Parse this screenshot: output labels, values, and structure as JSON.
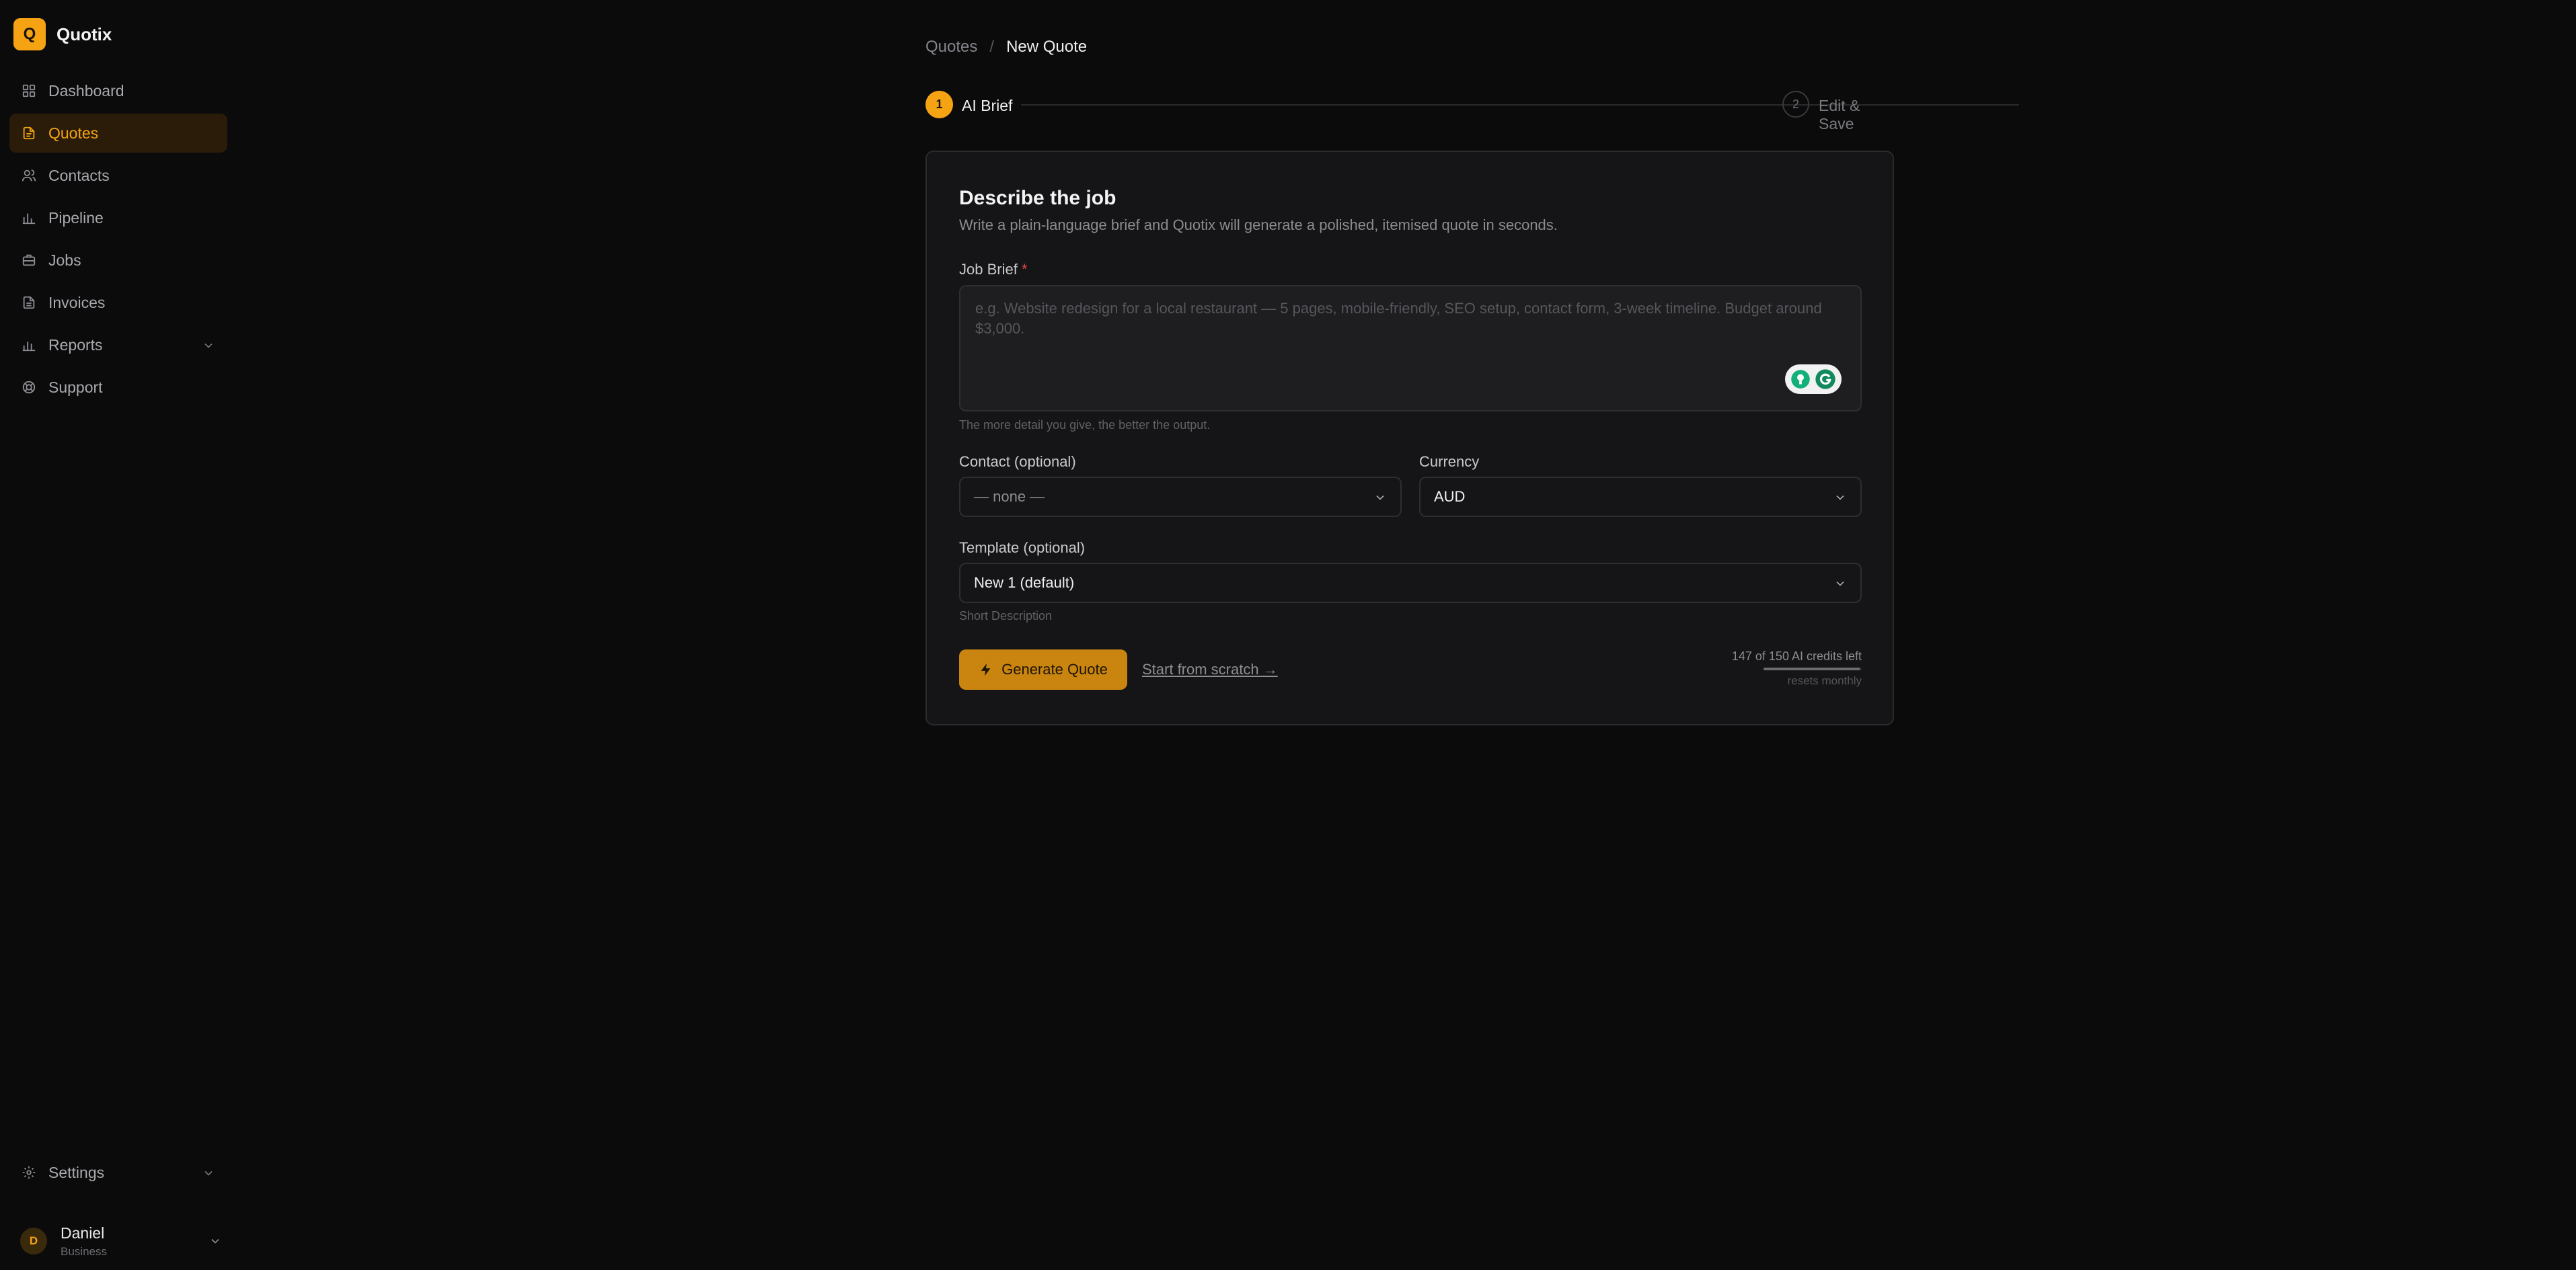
{
  "app": {
    "name": "Quotix",
    "logo_letter": "Q"
  },
  "sidebar": {
    "items": [
      {
        "label": "Dashboard",
        "icon": "grid-icon"
      },
      {
        "label": "Quotes",
        "icon": "document-icon",
        "active": true
      },
      {
        "label": "Contacts",
        "icon": "users-icon"
      },
      {
        "label": "Pipeline",
        "icon": "bar-chart-icon"
      },
      {
        "label": "Jobs",
        "icon": "briefcase-icon"
      },
      {
        "label": "Invoices",
        "icon": "invoice-icon"
      },
      {
        "label": "Reports",
        "icon": "bar-chart-icon",
        "has_chevron": true
      },
      {
        "label": "Support",
        "icon": "support-icon"
      }
    ],
    "settings_label": "Settings",
    "user": {
      "initial": "D",
      "name": "Daniel",
      "plan": "Business"
    }
  },
  "breadcrumb": {
    "parent": "Quotes",
    "separator": "/",
    "current": "New Quote"
  },
  "stepper": {
    "step1": {
      "number": "1",
      "label": "AI Brief"
    },
    "step2": {
      "number": "2",
      "label": "Edit & Save"
    }
  },
  "form": {
    "title": "Describe the job",
    "subtitle": "Write a plain-language brief and Quotix will generate a polished, itemised quote in seconds.",
    "job_brief": {
      "label": "Job Brief",
      "required_mark": "*",
      "placeholder": "e.g. Website redesign for a local restaurant — 5 pages, mobile-friendly, SEO setup, contact form, 3-week timeline. Budget around $3,000.",
      "hint": "The more detail you give, the better the output."
    },
    "contact": {
      "label": "Contact (optional)",
      "value": "— none —"
    },
    "currency": {
      "label": "Currency",
      "value": "AUD"
    },
    "template": {
      "label": "Template (optional)",
      "value": "New 1 (default)",
      "hint": "Short Description"
    },
    "generate_label": "Generate Quote",
    "scratch_label": "Start from scratch →",
    "credits": {
      "text": "147 of 150 AI credits left",
      "fraction_remaining": 0.98,
      "reset": "resets monthly"
    }
  },
  "colors": {
    "accent": "#f5a313",
    "background": "#0b0b0c",
    "card": "#151517"
  }
}
